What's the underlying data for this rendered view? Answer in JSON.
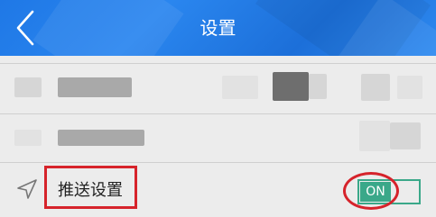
{
  "header": {
    "title": "设置",
    "back_icon": "chevron-left-icon"
  },
  "rows": [
    {
      "name": "redacted-row-1"
    },
    {
      "name": "redacted-row-2"
    },
    {
      "icon": "navigation-arrow-icon",
      "label": "推送设置",
      "toggle": {
        "state_label": "ON",
        "on": true
      }
    }
  ],
  "colors": {
    "header_blue": "#1f78e6",
    "toggle_green": "#3aa889",
    "highlight_red": "#d6232b"
  }
}
